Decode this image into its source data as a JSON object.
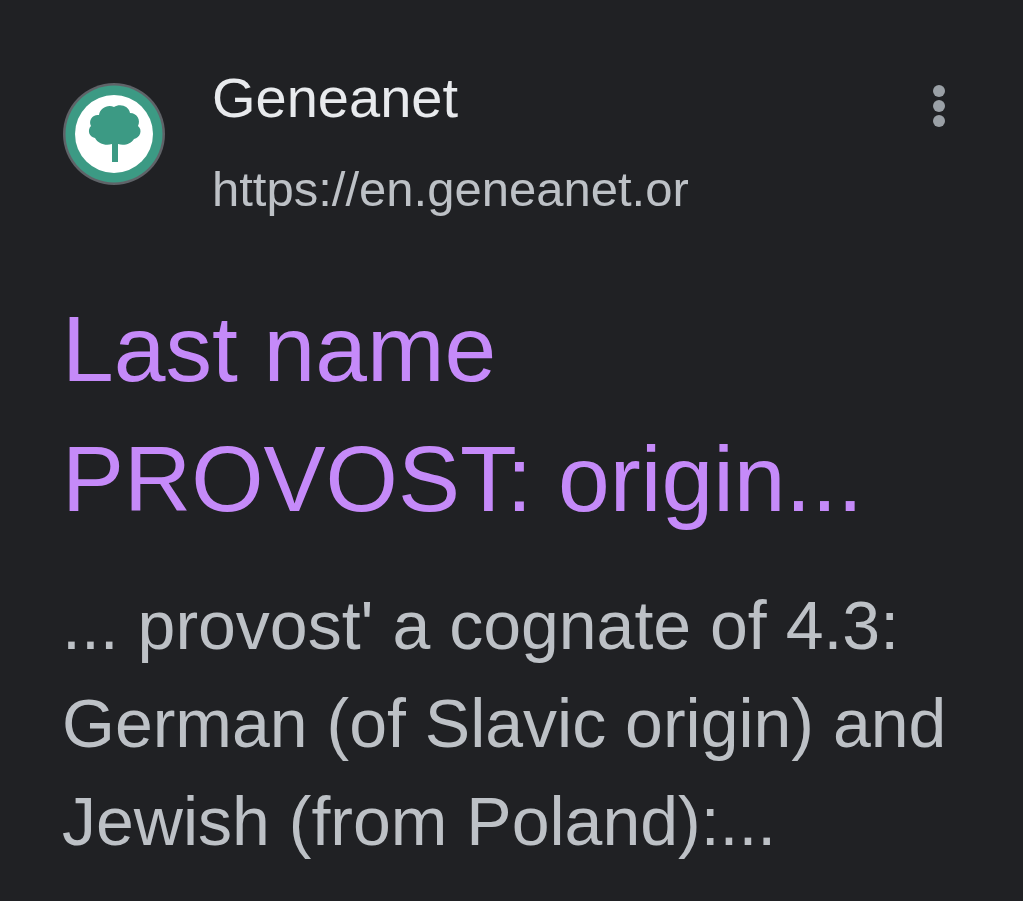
{
  "result": {
    "site_name": "Geneanet",
    "url": "https://en.geneanet.or",
    "title": "Last name PROVOST: origin...",
    "snippet": "... provost' a cognate of 4.3: German (of Slavic origin) and Jewish (from Poland):..."
  }
}
